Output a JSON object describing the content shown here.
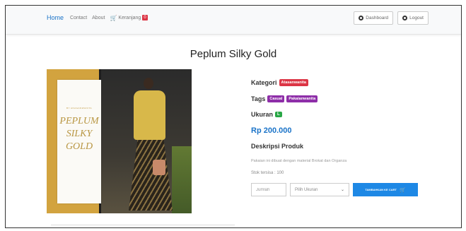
{
  "navbar": {
    "home": "Home",
    "contact": "Contact",
    "about": "About",
    "cart_icon": "shopping-cart-icon",
    "cart_label": "Keranjang",
    "cart_count": "0",
    "dashboard": "Dashboard",
    "logout": "Logout"
  },
  "product": {
    "title": "Peplum Silky Gold",
    "image_card_subtitle": "BY ANAGANWANITA",
    "image_title_lines": [
      "PEPLUM",
      "SILKY",
      "GOLD"
    ],
    "kategori_label": "Kategori",
    "kategori_value": "Atasanwanita",
    "tags_label": "Tags",
    "tags": [
      "Casual",
      "Pakaianwanita"
    ],
    "ukuran_label": "Ukuran",
    "ukuran_value": "L",
    "price": "Rp 200.000",
    "desc_heading": "Deskripsi Produk",
    "desc_text": "Pakaian ini dibuat dengan material Brokat dan Organza",
    "stock": "Stok tersisa : 100"
  },
  "form": {
    "qty_placeholder": "Jumlah",
    "size_placeholder": "Pilih Ukuran",
    "add_to_cart": "TAMBAHKAN KE CART"
  },
  "colors": {
    "accent": "#1a73c8",
    "button": "#1e88e5",
    "badge_red": "#dc3545",
    "badge_purple": "#8e2ea8",
    "badge_green": "#28a745",
    "gold": "#d2a33f"
  }
}
